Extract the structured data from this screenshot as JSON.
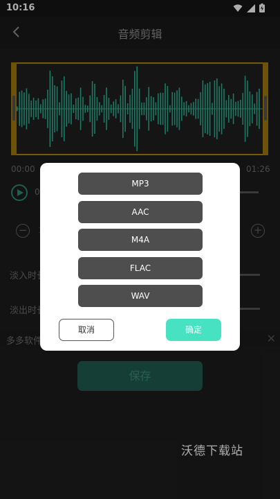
{
  "status": {
    "time": "10:16"
  },
  "header": {
    "title": "音频剪辑"
  },
  "timeline": {
    "start": "00:00",
    "end": "01:26",
    "position": "0"
  },
  "controls": {
    "fade_in_label": "淡入时长",
    "fade_out_label": "淡出时长"
  },
  "banner": {
    "text": "多多软件站"
  },
  "save_label": "保存",
  "watermark": "沃德下载站",
  "format_dialog": {
    "options": [
      "MP3",
      "AAC",
      "M4A",
      "FLAC",
      "WAV"
    ],
    "cancel_label": "取消",
    "confirm_label": "确定"
  },
  "colors": {
    "accent": "#47e2c2",
    "waveform": "#2bb394",
    "trim_handle": "#a17a10"
  }
}
